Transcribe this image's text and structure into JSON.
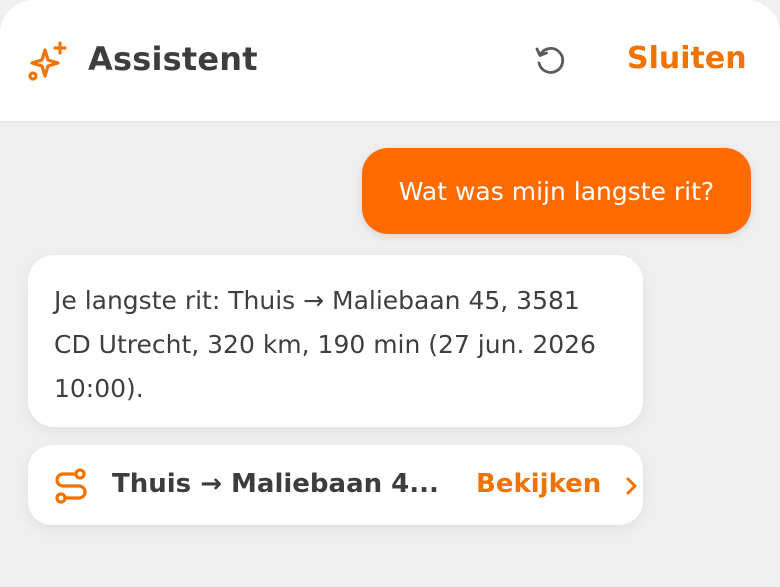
{
  "header": {
    "title": "Assistent",
    "close_label": "Sluiten"
  },
  "messages": {
    "user": "Wat was mijn langste rit?",
    "assistant": "Je langste rit: Thuis → Maliebaan 45, 3581 CD Utrecht, 320 km, 190 min (27 jun. 2026 10:00)."
  },
  "ride_card": {
    "title": "Thuis → Maliebaan 4...",
    "action_label": "Bekijken"
  },
  "icons": {
    "header": "sparkles-icon",
    "reset": "refresh-icon",
    "ride": "route-icon",
    "chevron": "chevron-right-icon"
  },
  "colors": {
    "accent": "#f07300",
    "user_bubble": "#ff6b00",
    "text": "#3d3d3d",
    "background": "#efefef"
  }
}
